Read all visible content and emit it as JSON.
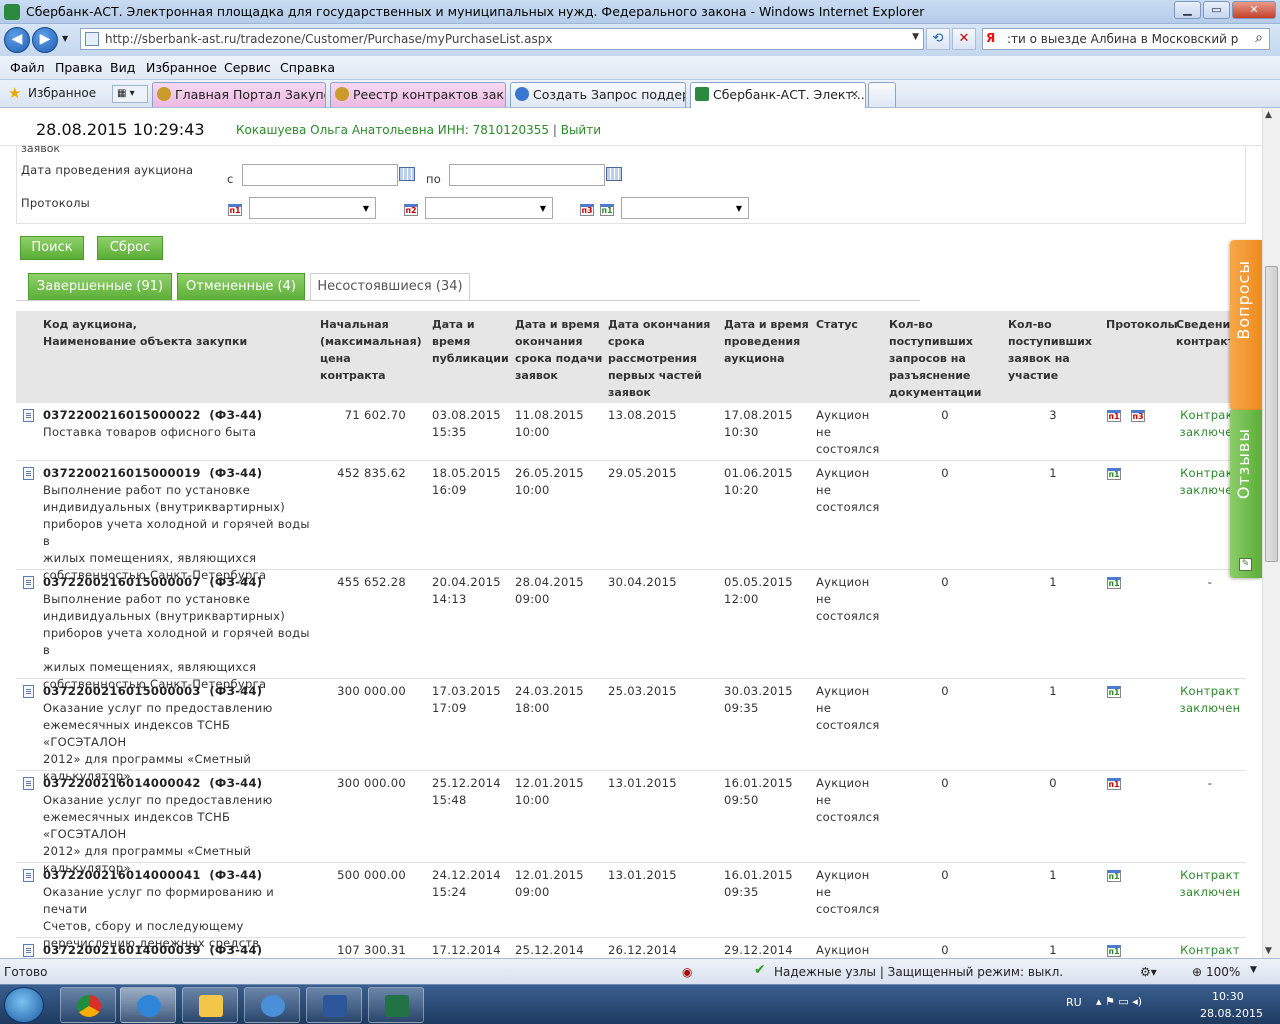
{
  "window": {
    "title": "Сбербанк-АСТ. Электронная площадка для государственных и муниципальных нужд. Федерального закона - Windows Internet Explorer",
    "minimize": "▁",
    "maximize": "▭",
    "close": "✕"
  },
  "browser": {
    "back": "◀",
    "forward": "▶",
    "url": "http://sberbank-ast.ru/tradezone/Customer/Purchase/myPurchaseList.aspx",
    "refresh": "⟲",
    "stop": "✕",
    "search_query": ":ти о выезде Албина в Московский район",
    "search_icon": "magnifier-icon"
  },
  "menu": [
    "Файл",
    "Правка",
    "Вид",
    "Избранное",
    "Сервис",
    "Справка"
  ],
  "favorites": {
    "label": "Избранное",
    "tabs": [
      {
        "label": "Главная Портал Закупок",
        "style": "pink"
      },
      {
        "label": "Реестр контрактов закры...",
        "style": "pink"
      },
      {
        "label": "Создать Запрос поддерж...",
        "style": "plain"
      },
      {
        "label": "Сбербанк-АСТ. Элект...",
        "style": "active",
        "close": "✕"
      }
    ]
  },
  "header": {
    "datetime": "28.08.2015  10:29:43",
    "user": "Кокашуева Ольга Анатольевна ИНН: 7810120355",
    "sep": "|",
    "logout": "Выйти"
  },
  "filter": {
    "cut_label": "заявок",
    "auction_date_label": "Дата проведения аукциона",
    "from": "с",
    "to": "по",
    "protocols_label": "Протоколы",
    "p1": "п1",
    "p2": "п2",
    "p3": "п3"
  },
  "buttons": {
    "search": "Поиск",
    "reset": "Сброс"
  },
  "tabs": [
    {
      "label": "Завершенные (91)"
    },
    {
      "label": "Отмененные (4)"
    },
    {
      "label": "Несостоявшиеся (34)"
    }
  ],
  "columns": [
    "Код аукциона,\nНаименование объекта закупки",
    "Начальная\n(максимальная)\nцена контракта",
    "Дата и время\nпубликации",
    "Дата и время\nокончания\nсрока подачи\nзаявок",
    "Дата окончания\nсрока\nрассмотрения\nпервых частей\nзаявок",
    "Дата и время\nпроведения\nаукциона",
    "Статус",
    "Кол-во\nпоступивших\nзапросов на\nразъяснение\nдокументации",
    "Кол-во\nпоступивших\nзаявок на\nучастие",
    "Протоколы",
    "Сведения о\nконтракте"
  ],
  "rows": [
    {
      "code": "0372200216015000022  (ФЗ-44)",
      "name": "Поставка товаров офисного быта",
      "price": "71 602.70",
      "pub": "03.08.2015\n15:35",
      "deadline": "11.08.2015\n10:00",
      "review": "13.08.2015",
      "auction": "17.08.2015\n10:30",
      "status": "Аукцион\nне\nсостоялся",
      "requests": "0",
      "bids": "3",
      "protocols": [
        "п1",
        "п3"
      ],
      "contract": "Контракт\nзаключен"
    },
    {
      "code": "0372200216015000019  (ФЗ-44)",
      "name": "Выполнение работ по установке\nиндивидуальных (внутриквартирных)\nприборов учета холодной и горячей воды в\nжилых помещениях, являющихся\nсобственностью Санкт-Петербурга",
      "price": "452 835.62",
      "pub": "18.05.2015\n16:09",
      "deadline": "26.05.2015\n10:00",
      "review": "29.05.2015",
      "auction": "01.06.2015\n10:20",
      "status": "Аукцион\nне\nсостоялся",
      "requests": "0",
      "bids": "1",
      "protocols": [
        "п1"
      ],
      "contract": "Контракт\nзаключен"
    },
    {
      "code": "0372200216015000007  (ФЗ-44)",
      "name": "Выполнение работ по установке\nиндивидуальных (внутриквартирных)\nприборов учета холодной и горячей воды в\nжилых помещениях, являющихся\nсобственностью Санкт-Петербурга",
      "price": "455 652.28",
      "pub": "20.04.2015\n14:13",
      "deadline": "28.04.2015\n09:00",
      "review": "30.04.2015",
      "auction": "05.05.2015\n12:00",
      "status": "Аукцион\nне\nсостоялся",
      "requests": "0",
      "bids": "1",
      "protocols": [
        "п1"
      ],
      "contract": "-"
    },
    {
      "code": "0372200216015000003  (ФЗ-44)",
      "name": "Оказание услуг по предоставлению\nежемесячных индексов ТСНБ «ГОСЭТАЛОН\n2012» для программы «Сметный\nкалькулятор»",
      "price": "300 000.00",
      "pub": "17.03.2015\n17:09",
      "deadline": "24.03.2015\n18:00",
      "review": "25.03.2015",
      "auction": "30.03.2015\n09:35",
      "status": "Аукцион\nне\nсостоялся",
      "requests": "0",
      "bids": "1",
      "protocols": [
        "п1"
      ],
      "contract": "Контракт\nзаключен"
    },
    {
      "code": "0372200216014000042  (ФЗ-44)",
      "name": "Оказание услуг по предоставлению\nежемесячных индексов ТСНБ «ГОСЭТАЛОН\n2012» для программы «Сметный\nкалькулятор»",
      "price": "300 000.00",
      "pub": "25.12.2014\n15:48",
      "deadline": "12.01.2015\n10:00",
      "review": "13.01.2015",
      "auction": "16.01.2015\n09:50",
      "status": "Аукцион\nне\nсостоялся",
      "requests": "0",
      "bids": "0",
      "protocols": [
        "п1"
      ],
      "contract": "-"
    },
    {
      "code": "0372200216014000041  (ФЗ-44)",
      "name": "Оказание услуг по формированию и печати\nСчетов, сбору и последующему\nперечислению денежных средств",
      "price": "500 000.00",
      "pub": "24.12.2014\n15:24",
      "deadline": "12.01.2015\n09:00",
      "review": "13.01.2015",
      "auction": "16.01.2015\n09:35",
      "status": "Аукцион\nне\nсостоялся",
      "requests": "0",
      "bids": "1",
      "protocols": [
        "п1"
      ],
      "contract": "Контракт\nзаключен"
    },
    {
      "code": "0372200216014000039  (ФЗ-44)",
      "name": "",
      "price": "107 300.31",
      "pub": "17.12.2014",
      "deadline": "25.12.2014",
      "review": "26.12.2014",
      "auction": "29.12.2014",
      "status": "Аукцион",
      "requests": "0",
      "bids": "1",
      "protocols": [
        "п1"
      ],
      "contract": "Контракт"
    }
  ],
  "side": {
    "questions": "Вопросы",
    "reviews": "Отзывы"
  },
  "statusbar": {
    "ready": "Готово",
    "trusted": "Надежные узлы | Защищенный режим: выкл.",
    "zoom": "100%"
  },
  "tray": {
    "lang": "RU",
    "time": "10:30",
    "date": "28.08.2015"
  }
}
